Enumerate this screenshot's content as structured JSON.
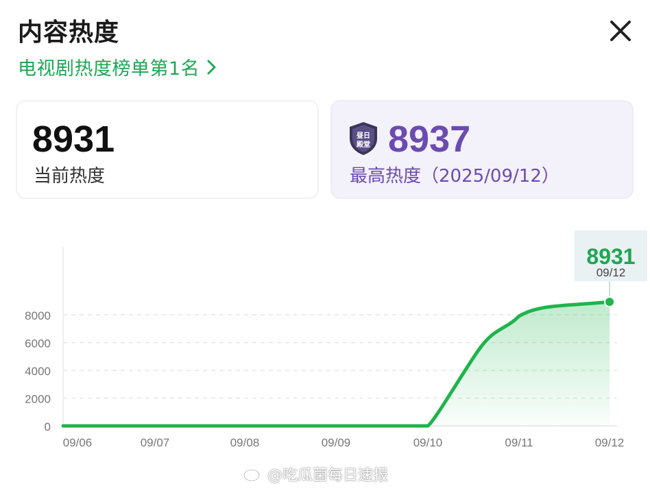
{
  "header": {
    "title": "内容热度",
    "rank_label": "电视剧热度榜单第1名"
  },
  "cards": {
    "current": {
      "value": "8931",
      "label": "当前热度"
    },
    "peak": {
      "value": "8937",
      "label": "最高热度（2025/09/12）",
      "badge_text": "昼日殿堂"
    }
  },
  "chart_data": {
    "type": "area",
    "x": [
      "09/06",
      "09/07",
      "09/08",
      "09/09",
      "09/10",
      "09/11",
      "09/12"
    ],
    "series": [
      {
        "values": [
          0,
          0,
          0,
          0,
          0,
          7900,
          8931
        ]
      }
    ],
    "yticks": [
      "8000",
      "6000",
      "4000",
      "2000",
      "0"
    ],
    "ylim": [
      0,
      9000
    ],
    "grid": true,
    "tooltip": {
      "value": "8931",
      "date": "09/12"
    },
    "colors": {
      "line": "#1fb44c",
      "fill": "#1fb44c"
    }
  },
  "watermark": "@吃瓜菌每日速报"
}
